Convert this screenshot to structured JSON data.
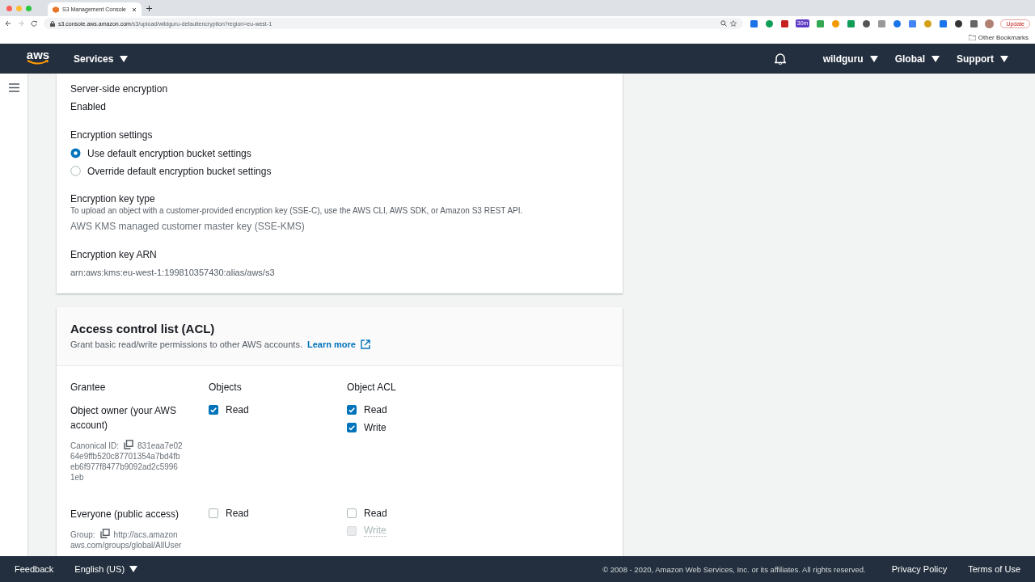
{
  "browser": {
    "tab_title": "S3 Management Console",
    "url_host": "s3.console.aws.amazon.com",
    "url_path": "/s3/upload/wildguru-defaultencryption?region=eu-west-1",
    "extension_badge": "30m",
    "update_button": "Update",
    "bookmarks": "Other Bookmarks"
  },
  "nav": {
    "logo": "aws",
    "services": "Services",
    "user": "wildguru",
    "region": "Global",
    "support": "Support"
  },
  "encryption": {
    "server_side_label": "Server-side encryption",
    "server_side_value": "Enabled",
    "settings_label": "Encryption settings",
    "options": [
      {
        "label": "Use default encryption bucket settings",
        "selected": true
      },
      {
        "label": "Override default encryption bucket settings",
        "selected": false
      }
    ],
    "key_type_label": "Encryption key type",
    "key_type_hint": "To upload an object with a customer-provided encryption key (SSE-C), use the AWS CLI, AWS SDK, or Amazon S3 REST API.",
    "key_type_value": "AWS KMS managed customer master key (SSE-KMS)",
    "arn_label": "Encryption key ARN",
    "arn_value": "arn:aws:kms:eu-west-1:199810357430:alias/aws/s3"
  },
  "acl": {
    "title": "Access control list (ACL)",
    "description": "Grant basic read/write permissions to other AWS accounts.",
    "learn_more": "Learn more",
    "columns": [
      "Grantee",
      "Objects",
      "Object ACL"
    ],
    "rows": [
      {
        "grantee": "Object owner (your AWS account)",
        "detail_label": "Canonical ID:",
        "detail_value": [
          "831eaa7e02",
          "64e9ffb520c87701354a7bd4fb",
          "eb6f977f8477b9092ad2c5996",
          "1eb"
        ],
        "objects": [
          {
            "label": "Read",
            "checked": true,
            "disabled": false
          }
        ],
        "object_acl": [
          {
            "label": "Read",
            "checked": true,
            "disabled": false
          },
          {
            "label": "Write",
            "checked": true,
            "disabled": false
          }
        ]
      },
      {
        "grantee": "Everyone (public access)",
        "detail_label": "Group:",
        "detail_value": [
          "http://acs.amazon",
          "aws.com/groups/global/AllUser"
        ],
        "objects": [
          {
            "label": "Read",
            "checked": false,
            "disabled": false
          }
        ],
        "object_acl": [
          {
            "label": "Read",
            "checked": false,
            "disabled": false
          },
          {
            "label": "Write",
            "checked": false,
            "disabled": true
          }
        ]
      }
    ]
  },
  "footer": {
    "feedback": "Feedback",
    "language": "English (US)",
    "copyright": "© 2008 - 2020, Amazon Web Services, Inc. or its affiliates. All rights reserved.",
    "privacy": "Privacy Policy",
    "terms": "Terms of Use"
  }
}
